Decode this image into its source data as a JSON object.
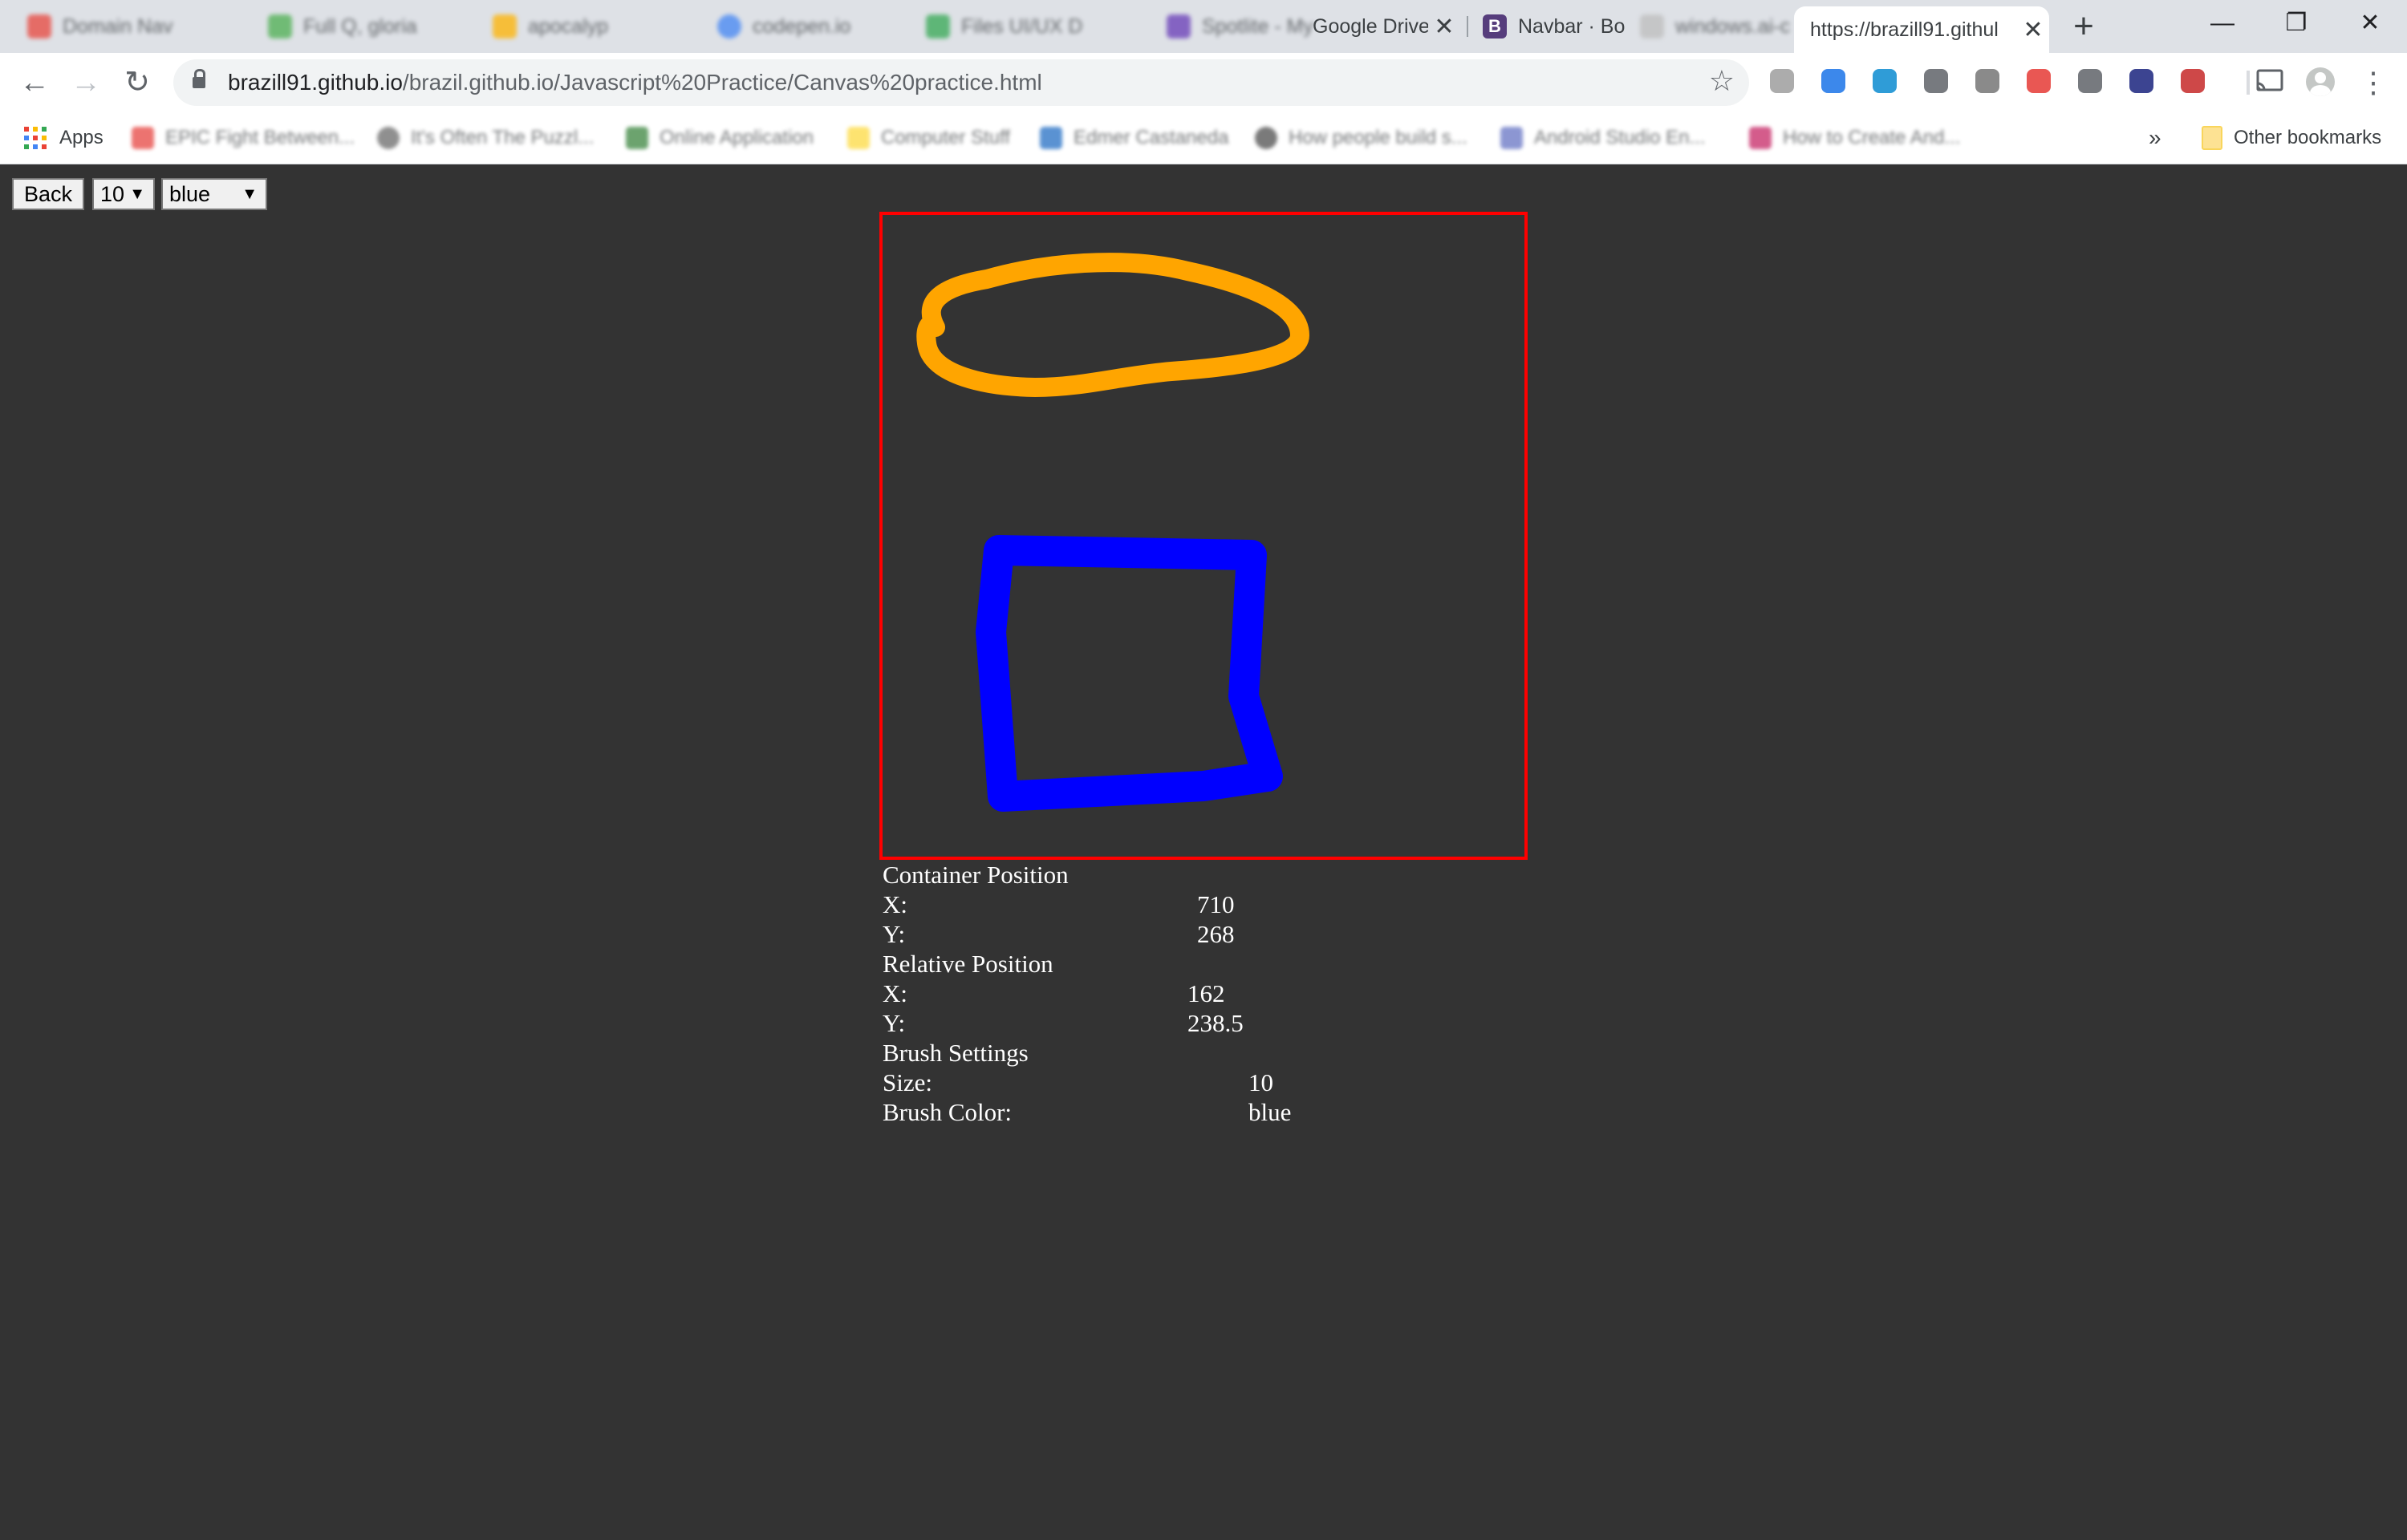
{
  "browser": {
    "tabs": [
      {
        "title": "Domain Nav",
        "favicon_color": "#e8453c",
        "favicon": "",
        "blurred": true
      },
      {
        "title": "Full Q, gloria",
        "favicon_color": "#4caf50",
        "favicon": "",
        "blurred": true
      },
      {
        "title": "apocalyp",
        "favicon_color": "#ffb300",
        "favicon": "",
        "blurred": true
      },
      {
        "title": "codepen.io",
        "favicon_color": "#4285f4",
        "favicon": "",
        "blurred": true
      },
      {
        "title": "Files UI/UX D",
        "favicon_color": "#34a853",
        "favicon": "",
        "blurred": true
      },
      {
        "title": "Spotlite - My",
        "favicon_color": "#673ab7",
        "favicon": "",
        "blurred": true
      },
      {
        "title": "Google Drive",
        "favicon_color": "#ffffff",
        "favicon": "",
        "blurred": false
      },
      {
        "title": "Navbar · Bo",
        "favicon_color": "#563d7c",
        "favicon": "B",
        "blurred": false
      },
      {
        "title": "windows.ai-c",
        "favicon_color": "#e0e0e0",
        "favicon": "",
        "blurred": true
      },
      {
        "title": "https://brazill91.githul",
        "favicon_color": "",
        "favicon": "",
        "blurred": false,
        "active": true
      }
    ],
    "new_tab_glyph": "+",
    "window_controls": {
      "minimize": "—",
      "restore": "❐",
      "close": "✕"
    },
    "url_host": "brazill91.github.io",
    "url_path": "/brazil.github.io/Javascript%20Practice/Canvas%20practice.html",
    "star_glyph": "☆",
    "extensions": [
      "#9e9e9e",
      "#1a73e8",
      "#0b8bd0",
      "#5f6368",
      "#757575",
      "#e53935",
      "#5f6368",
      "#1a237e",
      "#c62828"
    ],
    "bookmarks": {
      "apps_label": "Apps",
      "items": [
        {
          "label": "EPIC Fight Between...",
          "icon_color": "#e53935"
        },
        {
          "label": "It's Often The Puzzl...",
          "icon_color": "#616161"
        },
        {
          "label": "Online Application",
          "icon_color": "#2e7d32"
        },
        {
          "label": "Computer Stuff",
          "icon_color": "#fdd835"
        },
        {
          "label": "Edmer Castaneda",
          "icon_color": "#1565c0"
        },
        {
          "label": "How people build s...",
          "icon_color": "#424242"
        },
        {
          "label": "Android Studio En...",
          "icon_color": "#5c6bc0"
        },
        {
          "label": "How to Create And...",
          "icon_color": "#c2185b"
        }
      ],
      "overflow": "»",
      "other_label": "Other bookmarks"
    }
  },
  "page": {
    "back_button": "Back",
    "size_select": {
      "value": "10",
      "caret": "▼"
    },
    "color_select": {
      "value": "blue",
      "caret": "▼"
    },
    "canvas": {
      "border_color": "#ff0000",
      "strokes": [
        {
          "color": "orange"
        },
        {
          "color": "blue"
        }
      ]
    },
    "info": {
      "container_heading": "Container Position",
      "container_x_label": "X:",
      "container_x": "710",
      "container_y_label": "Y:",
      "container_y": "268",
      "relative_heading": "Relative Position",
      "relative_x_label": "X:",
      "relative_x": "162",
      "relative_y_label": "Y:",
      "relative_y": "238.5",
      "brush_heading": "Brush Settings",
      "size_label": "Size:",
      "size_value": "10",
      "color_label": "Brush Color:",
      "color_value": "blue"
    }
  }
}
